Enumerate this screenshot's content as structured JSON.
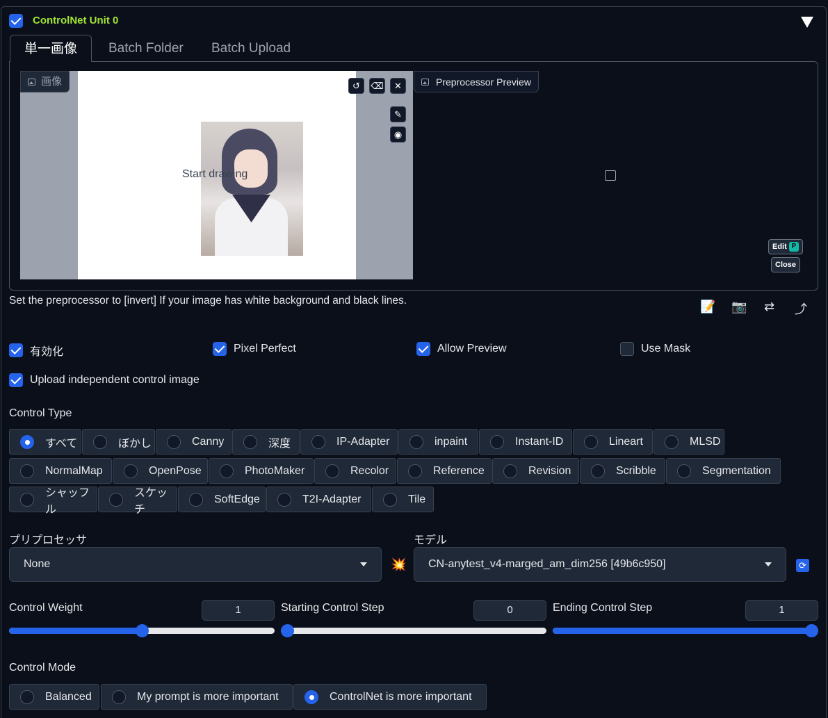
{
  "unit": {
    "title": "ControlNet Unit 0",
    "enabled": true
  },
  "tabs": [
    {
      "label": "単一画像",
      "active": true
    },
    {
      "label": "Batch Folder",
      "active": false
    },
    {
      "label": "Batch Upload",
      "active": false
    }
  ],
  "canvas": {
    "image_label": "画像",
    "start_drawing": "Start drawing",
    "preview_label": "Preprocessor Preview"
  },
  "preview_buttons": {
    "edit": "Edit",
    "close": "Close"
  },
  "hint": "Set the preprocessor to [invert] If your image has white background and black lines.",
  "toolbar_icons": [
    "📝",
    "📷",
    "⇄",
    "⤴"
  ],
  "options": {
    "enable": {
      "label": "有効化",
      "checked": true
    },
    "pixel_perfect": {
      "label": "Pixel Perfect",
      "checked": true
    },
    "allow_preview": {
      "label": "Allow Preview",
      "checked": true
    },
    "use_mask": {
      "label": "Use Mask",
      "checked": false
    },
    "upload_independent": {
      "label": "Upload independent control image",
      "checked": true
    }
  },
  "control_type": {
    "label": "Control Type",
    "items": [
      "すべて",
      "ぼかし",
      "Canny",
      "深度",
      "IP-Adapter",
      "inpaint",
      "Instant-ID",
      "Lineart",
      "MLSD",
      "NormalMap",
      "OpenPose",
      "PhotoMaker",
      "Recolor",
      "Reference",
      "Revision",
      "Scribble",
      "Segmentation",
      "シャッフル",
      "スケッチ",
      "SoftEdge",
      "T2I-Adapter",
      "Tile"
    ],
    "selected": "すべて"
  },
  "preprocessor": {
    "label": "プリプロセッサ",
    "value": "None"
  },
  "model": {
    "label": "モデル",
    "value": "CN-anytest_v4-marged_am_dim256 [49b6c950]"
  },
  "sliders": {
    "weight": {
      "label": "Control Weight",
      "value": "1",
      "fraction": 0.5
    },
    "start": {
      "label": "Starting Control Step",
      "value": "0",
      "fraction": 0.0
    },
    "end": {
      "label": "Ending Control Step",
      "value": "1",
      "fraction": 1.0
    }
  },
  "control_mode": {
    "label": "Control Mode",
    "items": [
      "Balanced",
      "My prompt is more important",
      "ControlNet is more important"
    ],
    "selected": "ControlNet is more important"
  },
  "colors": {
    "accent": "#2563eb",
    "title": "#a3e635",
    "bg": "#0b0f19"
  }
}
